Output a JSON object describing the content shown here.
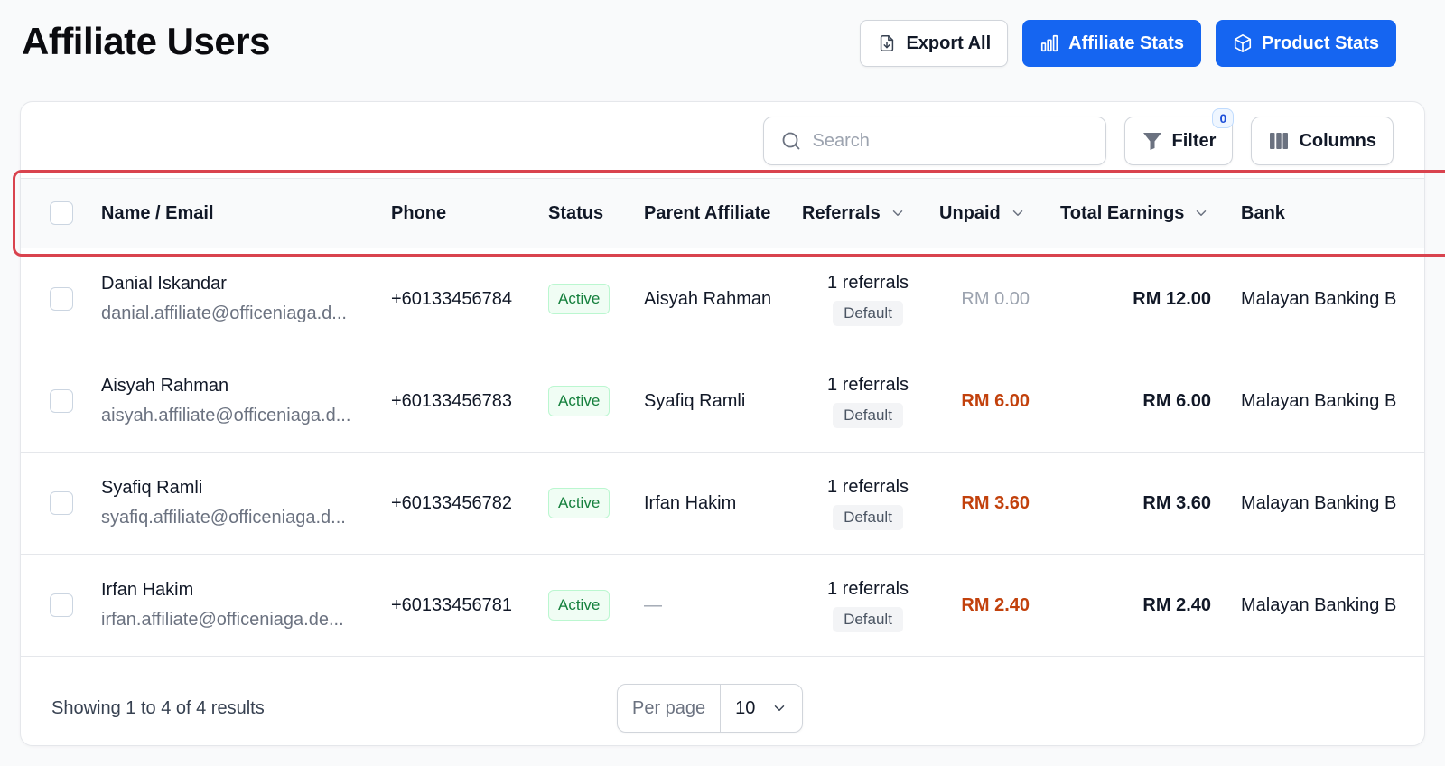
{
  "page": {
    "title": "Affiliate Users"
  },
  "header": {
    "export_label": "Export All",
    "affiliate_stats_label": "Affiliate Stats",
    "product_stats_label": "Product Stats"
  },
  "toolbar": {
    "search_placeholder": "Search",
    "filter_label": "Filter",
    "filter_count": "0",
    "columns_label": "Columns"
  },
  "table": {
    "columns": [
      "Name / Email",
      "Phone",
      "Status",
      "Parent Affiliate",
      "Referrals",
      "Unpaid",
      "Total Earnings",
      "Bank"
    ],
    "rows": [
      {
        "name": "Danial Iskandar",
        "email": "danial.affiliate@officeniaga.d...",
        "phone": "+60133456784",
        "status": "Active",
        "parent": "Aisyah Rahman",
        "referrals": "1 referrals",
        "referral_tag": "Default",
        "unpaid": "RM 0.00",
        "total": "RM 12.00",
        "bank": "Malayan Banking B"
      },
      {
        "name": "Aisyah Rahman",
        "email": "aisyah.affiliate@officeniaga.d...",
        "phone": "+60133456783",
        "status": "Active",
        "parent": "Syafiq Ramli",
        "referrals": "1 referrals",
        "referral_tag": "Default",
        "unpaid": "RM 6.00",
        "total": "RM 6.00",
        "bank": "Malayan Banking B"
      },
      {
        "name": "Syafiq Ramli",
        "email": "syafiq.affiliate@officeniaga.d...",
        "phone": "+60133456782",
        "status": "Active",
        "parent": "Irfan Hakim",
        "referrals": "1 referrals",
        "referral_tag": "Default",
        "unpaid": "RM 3.60",
        "total": "RM 3.60",
        "bank": "Malayan Banking B"
      },
      {
        "name": "Irfan Hakim",
        "email": "irfan.affiliate@officeniaga.de...",
        "phone": "+60133456781",
        "status": "Active",
        "parent": "—",
        "referrals": "1 referrals",
        "referral_tag": "Default",
        "unpaid": "RM 2.40",
        "total": "RM 2.40",
        "bank": "Malayan Banking B"
      }
    ]
  },
  "footer": {
    "showing_text": "Showing 1 to 4 of 4 results",
    "per_page_label": "Per page",
    "per_page_value": "10"
  },
  "colors": {
    "primary": "#1565f1",
    "active_green": "#15803d",
    "unpaid_orange": "#c2410c",
    "highlight_red": "#d9434e"
  }
}
